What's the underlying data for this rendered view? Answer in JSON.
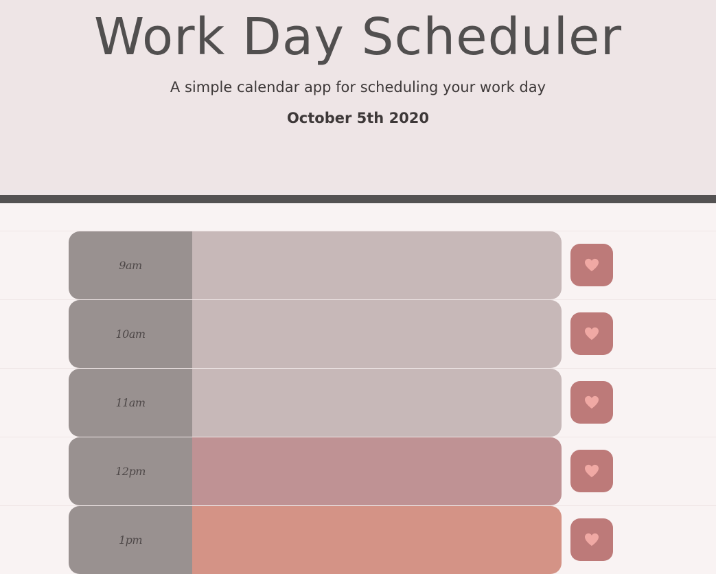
{
  "header": {
    "title": "Work Day Scheduler",
    "lead": "A simple calendar app for scheduling your work day",
    "current_day": "October 5th 2020"
  },
  "colors": {
    "past": "#c7b8b8",
    "present": "#bf9294",
    "future": "#d49386",
    "hour_bg": "#999190",
    "save_btn": "#bd7a79",
    "save_icon": "#f0a9a4"
  },
  "timeblocks": [
    {
      "hour": "9am",
      "status": "past",
      "text": "",
      "save_icon": "heart-icon"
    },
    {
      "hour": "10am",
      "status": "past",
      "text": "",
      "save_icon": "heart-icon"
    },
    {
      "hour": "11am",
      "status": "past",
      "text": "",
      "save_icon": "heart-icon"
    },
    {
      "hour": "12pm",
      "status": "present",
      "text": "",
      "save_icon": "heart-icon"
    },
    {
      "hour": "1pm",
      "status": "future",
      "text": "",
      "save_icon": "heart-icon"
    }
  ]
}
